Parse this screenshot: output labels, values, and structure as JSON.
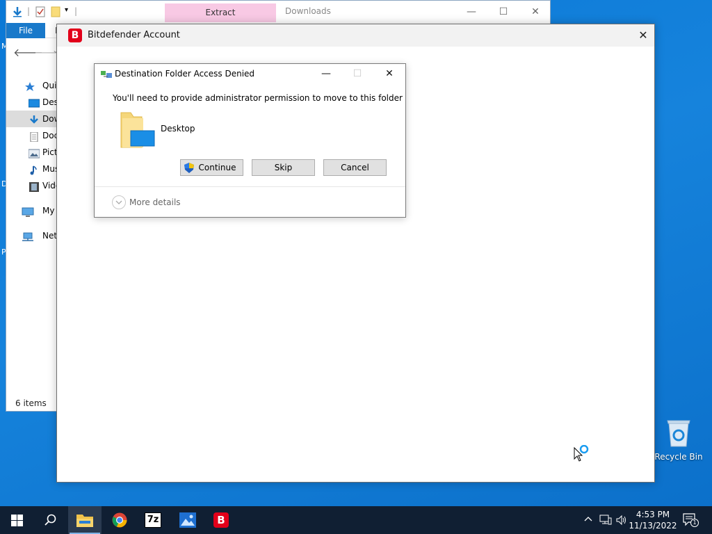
{
  "desktop": {
    "edge_letters": [
      "M",
      "D",
      "P"
    ],
    "recycle_bin_label": "Recycle Bin"
  },
  "explorer": {
    "contextual_tab": "Extract",
    "title": "Downloads",
    "ribbon": {
      "file_tab": "File",
      "home_tab_partial": "H"
    },
    "nav_items": [
      {
        "label": "Quick",
        "icon": "star-icon"
      },
      {
        "label": "Des",
        "icon": "desktop-icon"
      },
      {
        "label": "Dow",
        "icon": "download-icon",
        "selected": true
      },
      {
        "label": "Doc",
        "icon": "document-icon"
      },
      {
        "label": "Pict",
        "icon": "pictures-icon"
      },
      {
        "label": "Mus",
        "icon": "music-icon"
      },
      {
        "label": "Vide",
        "icon": "video-icon"
      },
      {
        "label": "My C",
        "icon": "computer-icon"
      },
      {
        "label": "Netw",
        "icon": "network-icon"
      }
    ],
    "status": "6 items"
  },
  "bitdefender": {
    "logo_letter": "B",
    "title": "Bitdefender Account"
  },
  "dialog": {
    "title": "Destination Folder Access Denied",
    "message": "You'll need to provide administrator permission to move to this folder",
    "folder_name": "Desktop",
    "buttons": {
      "continue": "Continue",
      "skip": "Skip",
      "cancel": "Cancel"
    },
    "more_details": "More details"
  },
  "taskbar": {
    "apps": [
      "start-button",
      "search",
      "file-explorer",
      "chrome",
      "7-zip",
      "photos",
      "bitdefender"
    ],
    "sevenzip_label": "7z",
    "bitdefender_label": "B",
    "clock_time": "4:53 PM",
    "clock_date": "11/13/2022",
    "notification_count": "1"
  },
  "colors": {
    "desktop_blue": "#0a78d6",
    "accent_blue": "#1979ca",
    "bitdefender_red": "#e2001a",
    "contextual_pink": "#f8c9e4",
    "taskbar": "#101f33"
  }
}
